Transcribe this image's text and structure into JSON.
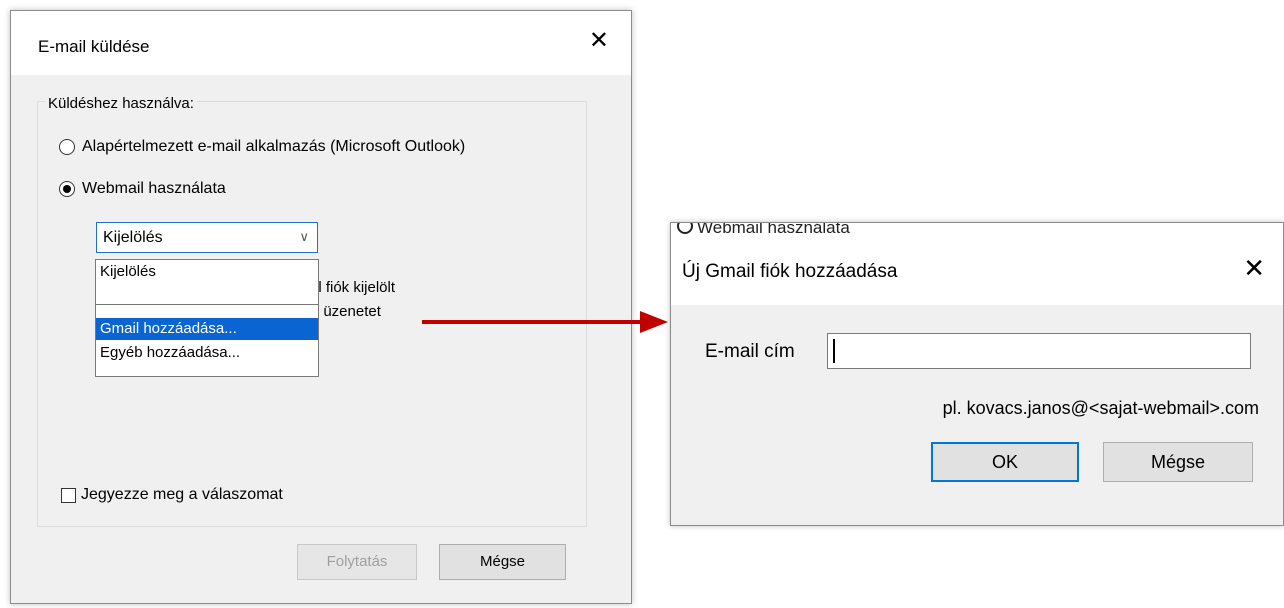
{
  "send_email_dialog": {
    "title": "E-mail küldése",
    "close_symbol": "✕",
    "group_label": "Küldéshez használva:",
    "option_default": "Alapértelmezett e-mail alkalmazás (Microsoft Outlook)",
    "option_webmail": "Webmail használata",
    "webmail_selected": true,
    "combo_value": "Kijelölés",
    "dropdown_items": [
      "Kijelölés",
      "Gmail hozzáadása...",
      "Egyéb hozzáadása..."
    ],
    "dropdown_highlighted": "Gmail hozzáadása...",
    "partial_text_line1": "il fiók kijelölt",
    "partial_text_line2": "/ üzenetet",
    "remember_label": "Jegyezze meg a válaszomat",
    "continue_label": "Folytatás",
    "cancel_label": "Mégse"
  },
  "arrow_color": "#c00000",
  "add_gmail_dialog": {
    "background_snippet": "Webmail használata",
    "title": "Új Gmail fiók hozzáadása",
    "close_symbol": "✕",
    "email_label": "E-mail cím",
    "email_value": "",
    "hint": "pl. kovacs.janos@<sajat-webmail>.com",
    "ok_label": "OK",
    "cancel_label": "Mégse"
  }
}
